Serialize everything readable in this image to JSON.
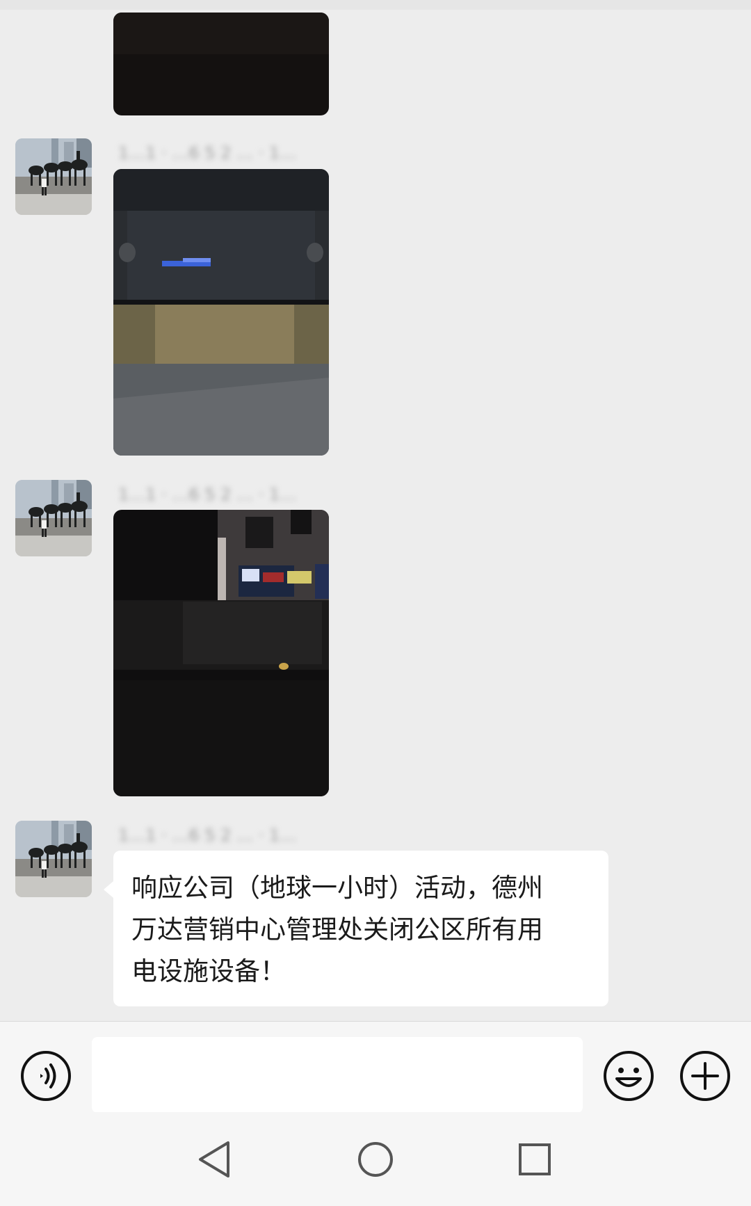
{
  "chat": {
    "messages": [
      {
        "type": "image",
        "sender": "",
        "image": "dark-photo-top-cropped",
        "avatar": "horse-statues-avatar"
      },
      {
        "type": "image",
        "sender": "1…1 · …6 5 2 … · 1…",
        "image": "dark-lobby-reception-desk-photo",
        "avatar": "horse-statues-avatar"
      },
      {
        "type": "image",
        "sender": "1…1 · …6 5 2 … · 1…",
        "image": "dark-window-night-photo",
        "avatar": "horse-statues-avatar"
      },
      {
        "type": "text",
        "sender": "1…1 · …6 5 2 … · 1…",
        "avatar": "horse-statues-avatar",
        "lines": [
          "响应公司（地球一小时）活动，德州",
          "万达营销中心管理处关闭公区所有用",
          "电设施设备！"
        ]
      }
    ]
  },
  "input_bar": {
    "voice_icon": "voice-icon",
    "text_value": "",
    "emoji_icon": "emoji-icon",
    "plus_icon": "plus-icon"
  },
  "nav_bar": {
    "back_icon": "back-triangle-icon",
    "home_icon": "home-circle-icon",
    "recents_icon": "recents-square-icon"
  },
  "colors": {
    "chat_background": "#ededed",
    "bubble": "#ffffff",
    "text": "#1a1a1a",
    "bar_background": "#f6f6f6"
  }
}
